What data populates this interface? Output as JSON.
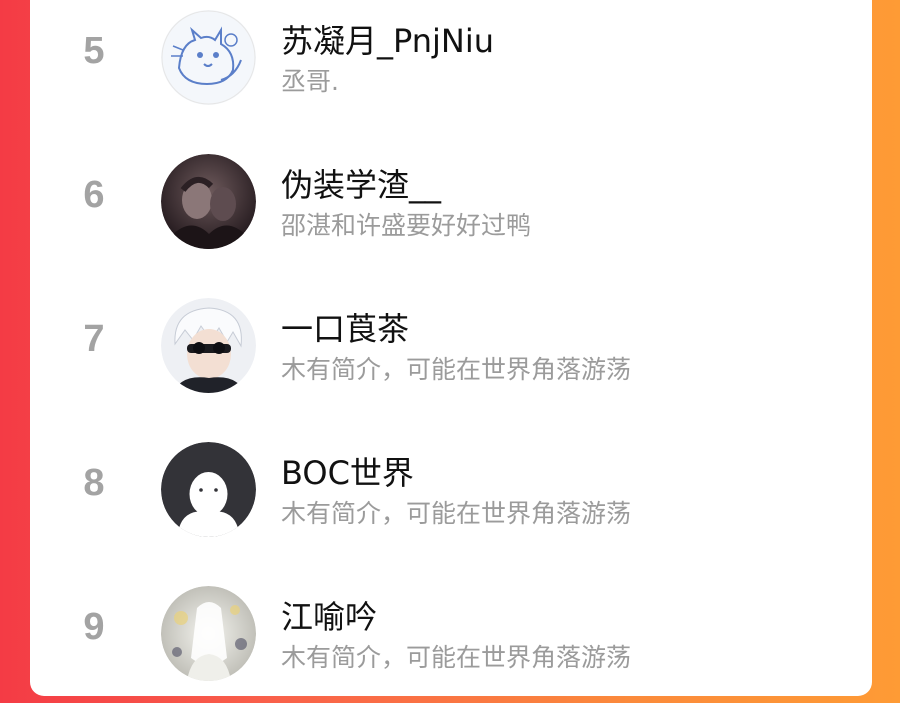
{
  "colors": {
    "background_gradient_start": "#f43b45",
    "background_gradient_end": "#fe9b35",
    "card": "#ffffff",
    "rank": "#a3a3a3",
    "name": "#111111",
    "bio": "#9b9b9b"
  },
  "leaderboard": {
    "entries": [
      {
        "rank": "5",
        "name": "苏凝月_PnjNiu",
        "bio": "丞哥.",
        "avatar": "cartoon-cats-avatar"
      },
      {
        "rank": "6",
        "name": "伪装学渣__",
        "bio": "邵湛和许盛要好好过鸭",
        "avatar": "dark-anime-avatar"
      },
      {
        "rank": "7",
        "name": "一口莨茶",
        "bio": "木有简介，可能在世界角落游荡",
        "avatar": "white-hair-anime-avatar"
      },
      {
        "rank": "8",
        "name": "BOC世界",
        "bio": "木有简介，可能在世界角落游荡",
        "avatar": "default-user-avatar"
      },
      {
        "rank": "9",
        "name": "江喻吟",
        "bio": "木有简介，可能在世界角落游荡",
        "avatar": "anime-figure-avatar"
      }
    ]
  }
}
